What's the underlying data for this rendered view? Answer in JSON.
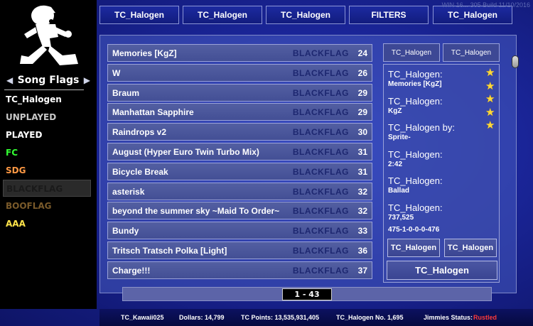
{
  "colors": {
    "fc": "#33ff33",
    "sdg": "#ff9944",
    "blackflag": "#1a1a1a",
    "booflag": "#7a5a2a",
    "aaa": "#ffe44a",
    "unplayed": "#c8c8c8",
    "rusted": "#ff3a3a"
  },
  "sidebar": {
    "title": "Song Flags",
    "items": [
      {
        "label": "TC_Halogen",
        "color": "#ffffff"
      },
      {
        "label": "UNPLAYED",
        "color": "#c8c8c8"
      },
      {
        "label": "PLAYED",
        "color": "#ffffff"
      },
      {
        "label": "FC",
        "color": "#33ff33"
      },
      {
        "label": "SDG",
        "color": "#ff9944"
      },
      {
        "label": "BLACKFLAG",
        "color": "#1a1a1a"
      },
      {
        "label": "BOOFLAG",
        "color": "#7a5a2a"
      },
      {
        "label": "AAA",
        "color": "#ffe44a"
      }
    ]
  },
  "top_tabs": [
    "TC_Halogen",
    "TC_Halogen",
    "TC_Halogen",
    "FILTERS",
    "TC_Halogen"
  ],
  "version": "WIN 16... 305 Build 11/10/2016",
  "songs": [
    {
      "title": "Memories [KgZ]",
      "flag": "BLACKFLAG",
      "level": "24"
    },
    {
      "title": "W",
      "flag": "BLACKFLAG",
      "level": "26"
    },
    {
      "title": "Braum",
      "flag": "BLACKFLAG",
      "level": "29"
    },
    {
      "title": "Manhattan Sapphire",
      "flag": "BLACKFLAG",
      "level": "29"
    },
    {
      "title": "Raindrops v2",
      "flag": "BLACKFLAG",
      "level": "30"
    },
    {
      "title": "August (Hyper Euro Twin Turbo Mix)",
      "flag": "BLACKFLAG",
      "level": "31"
    },
    {
      "title": "Bicycle Break",
      "flag": "BLACKFLAG",
      "level": "31"
    },
    {
      "title": "asterisk",
      "flag": "BLACKFLAG",
      "level": "32"
    },
    {
      "title": "beyond the summer sky ~Maid To Order~",
      "flag": "BLACKFLAG",
      "level": "32"
    },
    {
      "title": "Bundy",
      "flag": "BLACKFLAG",
      "level": "33"
    },
    {
      "title": "Tritsch Tratsch Polka [Light]",
      "flag": "BLACKFLAG",
      "level": "36"
    },
    {
      "title": "Charge!!!",
      "flag": "BLACKFLAG",
      "level": "37"
    }
  ],
  "info": {
    "tabs": [
      "TC_Halogen",
      "TC_Halogen"
    ],
    "stars": 5,
    "fields": [
      {
        "label": "TC_Halogen:",
        "value": "Memories [KgZ]"
      },
      {
        "label": "TC_Halogen:",
        "value": "KgZ"
      },
      {
        "label": "TC_Halogen by:",
        "value": "Sprite-"
      },
      {
        "label": "TC_Halogen:",
        "value": "2:42"
      },
      {
        "label": "TC_Halogen:",
        "value": "Ballad"
      },
      {
        "label": "TC_Halogen:",
        "value": "737,525",
        "value2": "475-1-0-0-0-476"
      }
    ],
    "buttons": [
      "TC_Halogen",
      "TC_Halogen"
    ],
    "wide_button": "TC_Halogen"
  },
  "pagination": "1 - 43",
  "status": {
    "user": "TC_Kawaii025",
    "dollars": "Dollars: 14,799",
    "points": "TC Points: 13,535,931,405",
    "halogen_no": "TC_Halogen No. 1,695",
    "jimmies_label": "Jimmies Status:",
    "jimmies_value": "Rustled"
  }
}
